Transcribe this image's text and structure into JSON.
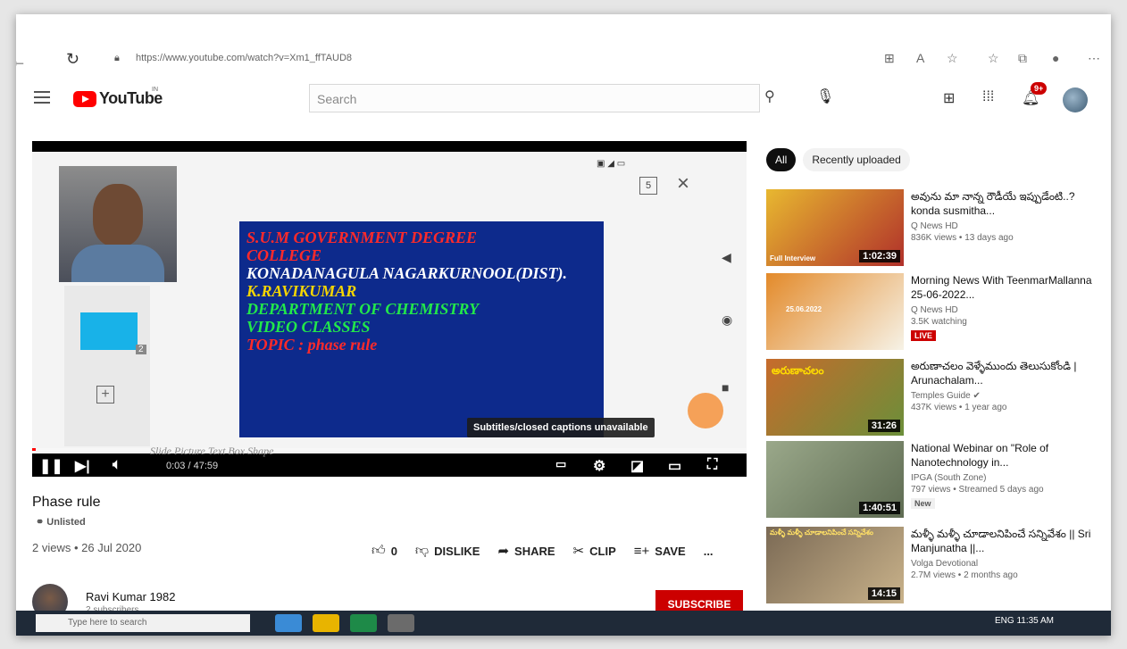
{
  "browser": {
    "url": "https://www.youtube.com/watch?v=Xm1_ffTAUD8"
  },
  "youtube": {
    "logo_text": "YouTube",
    "country": "IN",
    "search_placeholder": "Search",
    "notifications_badge": "9+"
  },
  "player": {
    "slide_lines": [
      {
        "text": "S.U.M GOVERNMENT DEGREE",
        "color": "red"
      },
      {
        "text": "COLLEGE",
        "color": "red"
      },
      {
        "text": "KONADANAGULA NAGARKURNOOL(DIST).",
        "color": "white"
      },
      {
        "text": "K.RAVIKUMAR",
        "color": "yellow"
      },
      {
        "text": "DEPARTMENT OF CHEMISTRY",
        "color": "green"
      },
      {
        "text": "VIDEO CLASSES",
        "color": "green"
      },
      {
        "text": "TOPIC :  phase rule",
        "color": "red"
      }
    ],
    "slide_thumb_number": "2",
    "slide_badge": "5",
    "caption_tooltip": "Subtitles/closed captions unavailable",
    "time_current": "0:03",
    "time_total": "47:59",
    "progress_fraction": 0.001,
    "toolbar_ghost": "Slide    Picture    Text Box    Shape"
  },
  "video": {
    "title": "Phase rule",
    "visibility": "Unlisted",
    "views_date": "2 views • 26 Jul 2020",
    "like_count": "0",
    "dislike_label": "DISLIKE",
    "share_label": "SHARE",
    "clip_label": "CLIP",
    "save_label": "SAVE",
    "more_label": "...",
    "channel_name": "Ravi Kumar 1982",
    "subscribers": "2 subscribers",
    "subscribe_label": "SUBSCRIBE"
  },
  "sidebar": {
    "chips": [
      "All",
      "Recently uploaded"
    ],
    "recommendations": [
      {
        "title": "అవును మా నాన్న రౌడీయే ఇప్పుడేంటి..? konda susmitha...",
        "channel": "Q News HD",
        "meta": "836K views • 13 days ago",
        "duration": "1:02:39",
        "badge": "",
        "thumb_colors": [
          "#e8b830",
          "#b0302a"
        ],
        "thumb_text": "Full Interview"
      },
      {
        "title": "Morning News With TeenmarMallanna 25-06-2022...",
        "channel": "Q News HD",
        "meta": "3.5K watching",
        "duration": "",
        "badge": "LIVE",
        "thumb_colors": [
          "#e38a2a",
          "#f6f2e6"
        ],
        "thumb_text": "25.06.2022"
      },
      {
        "title": "అరుణాచలం వెళ్ళేముందు తెలుసుకోండి | Arunachalam...",
        "channel": "Temples Guide ✔",
        "meta": "437K views • 1 year ago",
        "duration": "31:26",
        "badge": "",
        "thumb_colors": [
          "#c76b2b",
          "#6b8f3a"
        ],
        "thumb_text": "అరుణాచలం"
      },
      {
        "title": "National Webinar on \"Role of Nanotechnology in...",
        "channel": "IPGA (South Zone)",
        "meta": "797 views • Streamed 5 days ago",
        "duration": "1:40:51",
        "badge": "New",
        "thumb_colors": [
          "#9aa88a",
          "#5e6b52"
        ],
        "thumb_text": ""
      },
      {
        "title": "మళ్ళీ మళ్ళీ చూడాలనిపించే సన్నివేశం || Sri Manjunatha ||...",
        "channel": "Volga Devotional",
        "meta": "2.7M views • 2 months ago",
        "duration": "14:15",
        "badge": "",
        "thumb_colors": [
          "#7b6a55",
          "#c9b28a"
        ],
        "thumb_text": "మళ్ళీ మళ్ళీ చూడాలనిపించే సన్నివేశం"
      }
    ]
  },
  "taskbar": {
    "search_placeholder": "Type here to search",
    "tray_text": "ENG  11:35 AM"
  }
}
